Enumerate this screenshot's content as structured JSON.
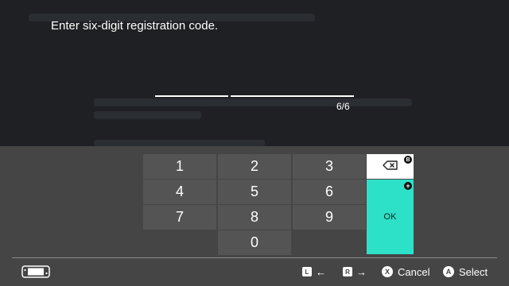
{
  "dialog": {
    "prompt": "Enter six-digit registration code.",
    "counter": "6/6",
    "code_value": ""
  },
  "keypad": {
    "keys": [
      "1",
      "2",
      "3",
      "4",
      "5",
      "6",
      "7",
      "8",
      "9",
      "0"
    ],
    "ok_label": "OK",
    "backspace_icon": "backspace-icon",
    "backspace_badge": "B",
    "ok_badge": "+"
  },
  "footer": {
    "console_icon": "switch-console-icon",
    "left": {
      "button": "L",
      "arrow": "←"
    },
    "right": {
      "button": "R",
      "arrow": "→"
    },
    "cancel": {
      "button": "X",
      "label": "Cancel"
    },
    "select": {
      "button": "A",
      "label": "Select"
    }
  },
  "colors": {
    "ok_key": "#2de0c8",
    "keyboard_bg": "#454545",
    "key_bg": "#545454",
    "overlay_bg": "#1e2023"
  }
}
